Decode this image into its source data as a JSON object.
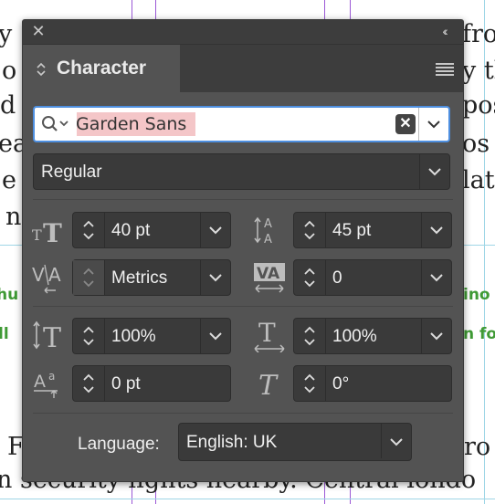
{
  "document": {
    "lines": [
      "y",
      "o",
      "d",
      "ea",
      "e",
      "n"
    ],
    "right_fragments": [
      "fro",
      "y th",
      "posi",
      "os",
      "lat"
    ],
    "green_left": [
      "hu",
      "ll"
    ],
    "green_right": [
      "ino",
      "n fo"
    ],
    "bottom_left": "F",
    "bottom_right": "ro",
    "last_line": "n security lights nearby. Central londo"
  },
  "panel": {
    "title_tab": "Character",
    "close_icon": "close-icon",
    "collapse_icon": "double-chevron-icon",
    "menu_icon": "panel-menu-icon",
    "font_family": {
      "value": "Garden Sans",
      "search_icon": "search-icon"
    },
    "font_style": "Regular",
    "font_size": "40 pt",
    "leading": "45 pt",
    "kerning": "Metrics",
    "tracking": "0",
    "vertical_scale": "100%",
    "horizontal_scale": "100%",
    "baseline_shift": "0 pt",
    "skew": "0°",
    "language_label": "Language:",
    "language": "English: UK"
  },
  "colors": {
    "panel_bg": "#535353",
    "field_bg": "#3a3a3a",
    "focus_border": "#4e8fe0",
    "highlight": "#f4c6c8",
    "green_text": "#3f9a35"
  }
}
